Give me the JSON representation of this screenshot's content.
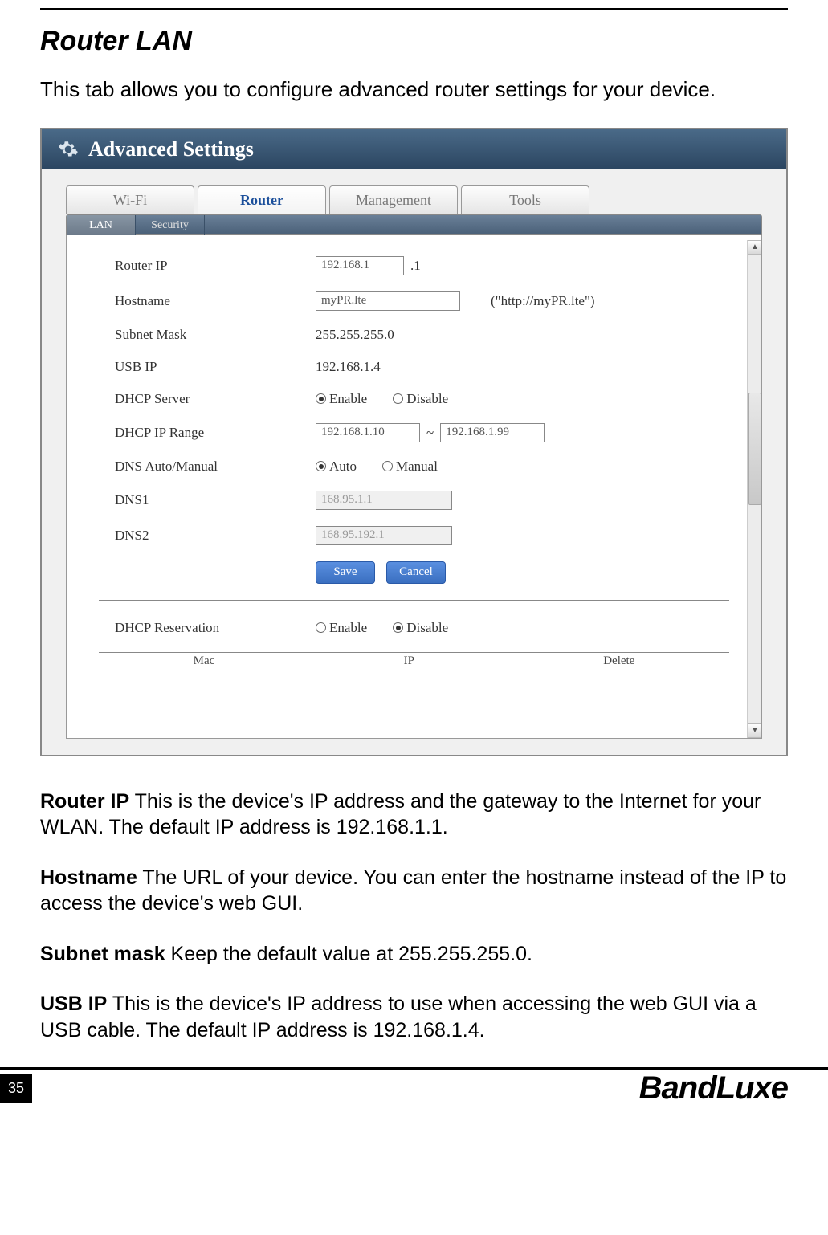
{
  "section_title": "Router LAN",
  "intro": "This tab allows you to configure advanced router settings for your device.",
  "ui": {
    "window_title": "Advanced Settings",
    "main_tabs": [
      "Wi-Fi",
      "Router",
      "Management",
      "Tools"
    ],
    "main_tab_active_index": 1,
    "sub_tabs": [
      "LAN",
      "Security"
    ],
    "sub_tab_active_index": 0,
    "form": {
      "router_ip": {
        "label": "Router IP",
        "value": "192.168.1",
        "suffix": ".1"
      },
      "hostname": {
        "label": "Hostname",
        "value": "myPR.lte",
        "hint": "(\"http://myPR.lte\")"
      },
      "subnet_mask": {
        "label": "Subnet Mask",
        "value": "255.255.255.0"
      },
      "usb_ip": {
        "label": "USB IP",
        "value": "192.168.1.4"
      },
      "dhcp_server": {
        "label": "DHCP Server",
        "options": [
          "Enable",
          "Disable"
        ],
        "selected": "Enable"
      },
      "dhcp_range": {
        "label": "DHCP IP Range",
        "start": "192.168.1.10",
        "end": "192.168.1.99",
        "sep": "~"
      },
      "dns_mode": {
        "label": "DNS Auto/Manual",
        "options": [
          "Auto",
          "Manual"
        ],
        "selected": "Auto"
      },
      "dns1": {
        "label": "DNS1",
        "value": "168.95.1.1"
      },
      "dns2": {
        "label": "DNS2",
        "value": "168.95.192.1"
      },
      "save_label": "Save",
      "cancel_label": "Cancel",
      "dhcp_reservation": {
        "label": "DHCP Reservation",
        "options": [
          "Enable",
          "Disable"
        ],
        "selected": "Disable"
      },
      "res_columns": [
        "Mac",
        "IP",
        "Delete"
      ]
    }
  },
  "descriptions": [
    {
      "term": "Router IP",
      "text": " This is the device's IP address and the gateway to the Internet for your WLAN. The default IP address is 192.168.1.1."
    },
    {
      "term": "Hostname",
      "text": " The URL of your device. You can enter the hostname instead of the IP to access the device's web GUI."
    },
    {
      "term": "Subnet mask",
      "text": " Keep the default value at 255.255.255.0."
    },
    {
      "term": "USB IP",
      "text": " This is the device's IP address to use when accessing the web GUI via a USB cable. The default IP address is 192.168.1.4."
    }
  ],
  "footer": {
    "page_number": "35",
    "brand": "BandLuxe"
  }
}
